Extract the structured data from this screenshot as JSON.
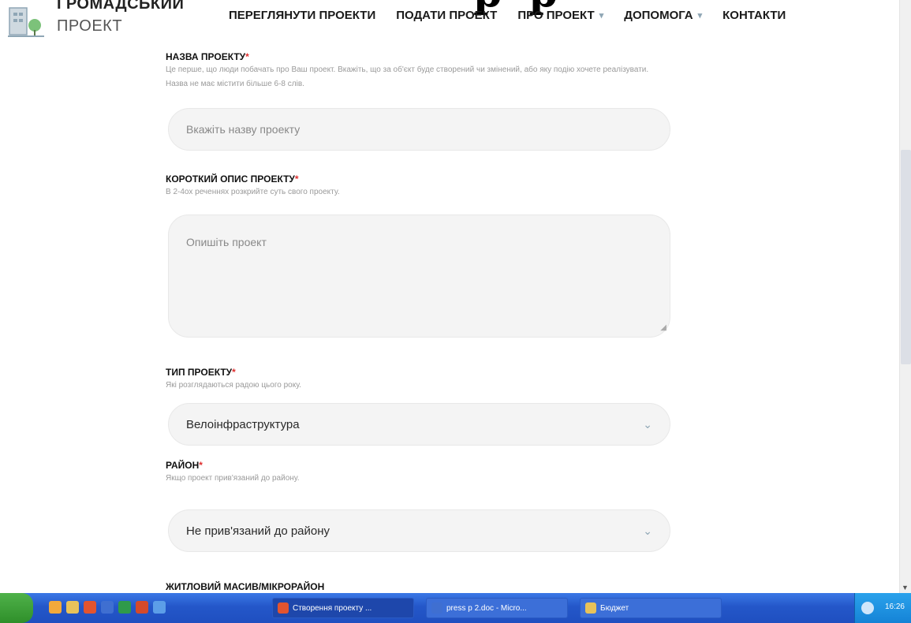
{
  "header": {
    "logo_line1": "ГРОМАДСЬКИЙ",
    "logo_line2": "ПРОЕКТ",
    "big_title": "р р",
    "nav": [
      {
        "label": "ПЕРЕГЛЯНУТИ ПРОЕКТИ"
      },
      {
        "label": "ПОДАТИ ПРОЕКТ"
      },
      {
        "label": "ПРО ПРОЕКТ",
        "caret": "▾"
      },
      {
        "label": "ДОПОМОГА",
        "caret": "▾"
      },
      {
        "label": "КОНТАКТИ"
      }
    ]
  },
  "form": {
    "name": {
      "label": "НАЗВА ПРОЕКТУ",
      "required": "*",
      "hint": "Це перше, що люди побачать про Ваш проект. Вкажіть, що за об'єкт буде створений чи змінений, або яку подію хочете реалізувати. Назва не має містити більше 6-8 слів.",
      "placeholder": "Вкажіть назву проекту"
    },
    "description": {
      "label": "КОРОТКИЙ ОПИС ПРОЕКТУ",
      "required": "*",
      "hint": "В 2-4ох реченнях розкрийте суть свого проекту.",
      "placeholder": "Опишіть проект"
    },
    "type": {
      "label": "ТИП ПРОЕКТУ",
      "required": "*",
      "hint": "Які розглядаються радою цього року.",
      "value": "Велоінфраструктура"
    },
    "district": {
      "label": "РАЙОН",
      "required": "*",
      "hint": "Якщо проект прив'язаний до району.",
      "value": "Не прив'язаний до району"
    },
    "microdistrict": {
      "label": "ЖИТЛОВИЙ МАСИВ/МІКРОРАЙОН"
    }
  },
  "taskbar": {
    "tasks": [
      {
        "label": "Створення проекту ...",
        "active": true
      },
      {
        "label": "press p 2.doc - Micro...",
        "active": false
      },
      {
        "label": "Бюджет",
        "active": false
      }
    ],
    "clock": "16:26"
  },
  "colors": {
    "accent": "#8fa6b5",
    "required": "#e03030",
    "field_bg": "#f4f4f4",
    "taskbar": "#2457c9"
  }
}
